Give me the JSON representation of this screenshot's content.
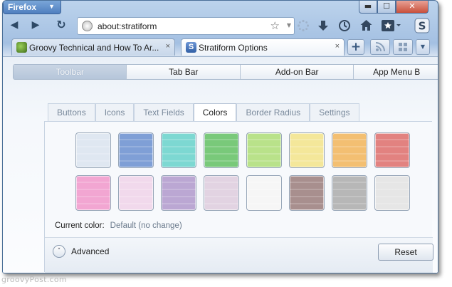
{
  "app": {
    "menu_label": "Firefox",
    "menu_arrow": "▼"
  },
  "window_controls": {
    "minimize": "▬",
    "maximize": "☐",
    "close": "✕"
  },
  "navbar": {
    "back_icon": "◀",
    "forward_icon": "▶",
    "reload_icon": "↻",
    "url": "about:stratiform",
    "star_icon": "☆",
    "dropdown_icon": "▼",
    "icons": [
      "loading-icon",
      "download-icon",
      "history-icon",
      "home-icon",
      "bookmarks-icon",
      "stratiform-icon"
    ]
  },
  "tabs": [
    {
      "title": "Groovy Technical and How To Ar...",
      "close": "×",
      "active": false,
      "favicon_color": "#5c8a2e"
    },
    {
      "title": "Stratiform Options",
      "close": "×",
      "active": true,
      "favicon_color": "#3f6fb5"
    }
  ],
  "tabbar_buttons": {
    "new_tab": "+"
  },
  "topnav": [
    "Toolbar",
    "Tab Bar",
    "Add-on Bar",
    "App Menu B"
  ],
  "subtabs": [
    "Buttons",
    "Icons",
    "Text Fields",
    "Colors",
    "Border Radius",
    "Settings"
  ],
  "colors": {
    "row1": [
      "#dfe7f1",
      "#7f9fd6",
      "#7dd8d2",
      "#79c97a",
      "#b9e28a",
      "#f4e79a",
      "#f3bf72",
      "#e28280"
    ],
    "row2": [
      "#f2a6d2",
      "#f1d9ec",
      "#bba7d3",
      "#e2d3e2",
      "#f6f6f6",
      "#a88f8e",
      "#b7b7b7",
      "#e6e6e6"
    ]
  },
  "current_color": {
    "label": "Current color:",
    "value": "Default (no change)"
  },
  "advanced": {
    "label": "Advanced",
    "icon": "˅"
  },
  "reset_label": "Reset",
  "watermark": "groovyPost.com"
}
